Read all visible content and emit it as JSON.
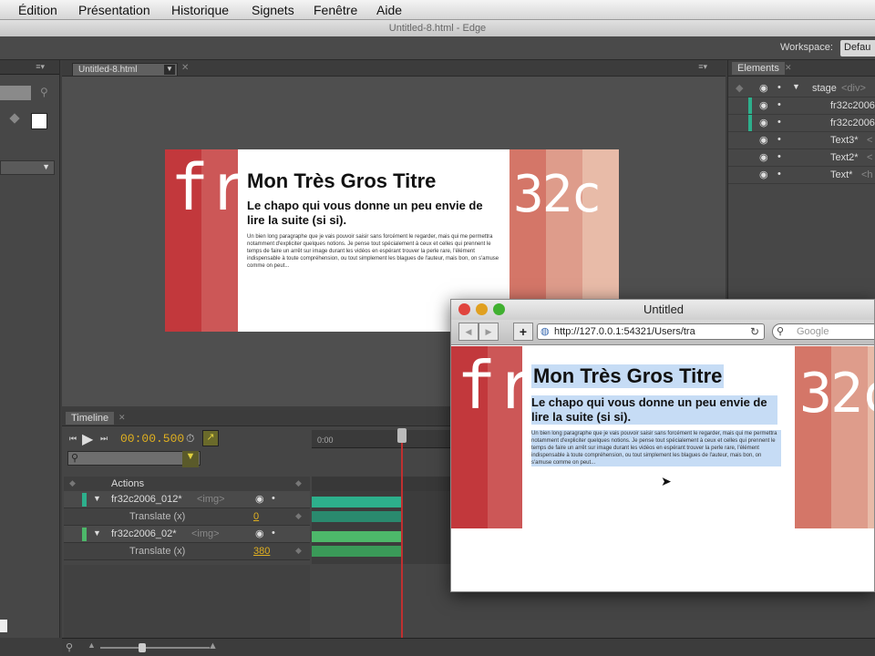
{
  "menu": [
    "Édition",
    "Présentation",
    "Historique",
    "Signets",
    "Fenêtre",
    "Aide"
  ],
  "window_title": "Untitled-8.html - Edge",
  "workspace": {
    "label": "Workspace:",
    "value": "Defau"
  },
  "doc_tab": "Untitled-8.html",
  "stage": {
    "title": "Mon Très Gros Titre",
    "chapo": "Le chapo qui vous donne un peu envie de lire la suite (si si).",
    "paragraph": "Un bien long paragraphe que je vais pouvoir saisir sans forcément le regarder, mais qui me permettra notamment d'expliciter quelques notions. Je pense tout spécialement à ceux et celles qui prennent le temps de faire un arrêt sur image durant les vidéos en espérant trouver la perle rare, l'élément indispensable à toute compréhension, ou tout simplement les blagues de l'auteur, mais bon, on s'amuse comme on peut...",
    "logo_left": "fr",
    "logo_right": "32c",
    "colors": {
      "red1": "#c2383c",
      "red2": "#cc5555",
      "salmon1": "#d87a6e",
      "salmon2": "#e2a090",
      "salmon3": "#ebc0b0"
    }
  },
  "elements": {
    "tab": "Elements",
    "rows": [
      {
        "name": "stage",
        "tag": "<div>"
      },
      {
        "name": "fr32c2006",
        "tag": ""
      },
      {
        "name": "fr32c2006",
        "tag": ""
      },
      {
        "name": "Text3*",
        "tag": "<"
      },
      {
        "name": "Text2*",
        "tag": "<"
      },
      {
        "name": "Text*",
        "tag": "<h"
      }
    ]
  },
  "timeline": {
    "tab": "Timeline",
    "time": "00:00.500",
    "ruler_start": "0:00",
    "actions_label": "Actions",
    "rows": [
      {
        "name": "fr32c2006_012*",
        "tag": "<img>",
        "prop": "Translate (x)",
        "value": "0"
      },
      {
        "name": "fr32c2006_02*",
        "tag": "<img>",
        "prop": "Translate (x)",
        "value": "380"
      }
    ]
  },
  "browser": {
    "title": "Untitled",
    "url": "http://127.0.0.1:54321/Users/tra",
    "search_placeholder": "Google"
  }
}
